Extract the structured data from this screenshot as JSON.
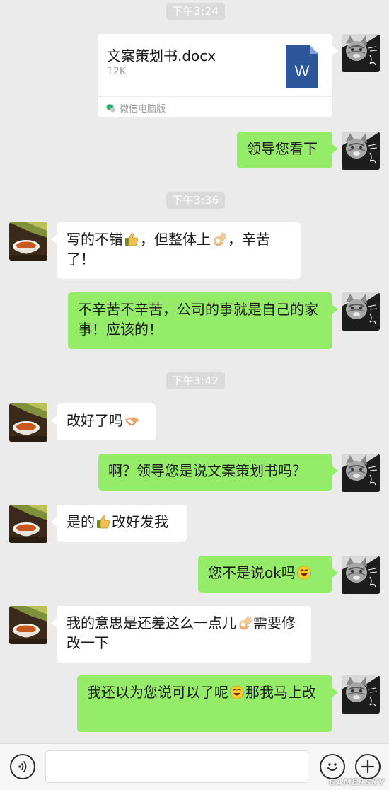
{
  "timestamps": [
    "下午3:24",
    "下午3:36",
    "下午3:42"
  ],
  "file": {
    "name": "文案策划书.docx",
    "size": "12K",
    "icon_letter": "W",
    "source": "微信电脑版"
  },
  "messages": {
    "m1": {
      "sender": "me",
      "text": "领导您看下"
    },
    "m2": {
      "sender": "them",
      "parts": [
        "写的不错",
        "，但整体上",
        "，辛苦了！"
      ],
      "emoji": [
        "thumbs-up-emoji",
        "ok-hand-emoji"
      ]
    },
    "m3": {
      "sender": "me",
      "text": "不辛苦不辛苦，公司的事就是自己的家事！应该的！"
    },
    "m4": {
      "sender": "them",
      "parts": [
        "改好了吗"
      ],
      "emoji": [
        "handshake-emoji"
      ]
    },
    "m5": {
      "sender": "me",
      "text": "啊？领导您是说文案策划书吗？"
    },
    "m6": {
      "sender": "them",
      "parts": [
        "是的",
        "改好发我"
      ],
      "emoji": [
        "thumbs-up-emoji"
      ]
    },
    "m7": {
      "sender": "me",
      "parts": [
        "您不是说ok吗"
      ],
      "emoji": [
        "tears-of-joy-emoji"
      ]
    },
    "m8": {
      "sender": "them",
      "parts": [
        "我的意思是还差这么一点儿",
        "需要修改一下"
      ],
      "emoji": [
        "ok-hand-emoji"
      ]
    },
    "m9": {
      "sender": "me",
      "parts": [
        "我还以为您说可以了呢",
        "那我马上改"
      ],
      "emoji": [
        "tears-of-joy-emoji"
      ]
    }
  },
  "input_bar": {
    "value": "",
    "icons": [
      "voice-icon",
      "emoji-icon",
      "plus-icon"
    ]
  },
  "watermark": "GAMERSKY",
  "colors": {
    "background": "#ebebeb",
    "my_bubble": "#95ec69",
    "their_bubble": "#ffffff",
    "timestamp_bg": "#dadada",
    "word_icon": "#2b579a"
  }
}
